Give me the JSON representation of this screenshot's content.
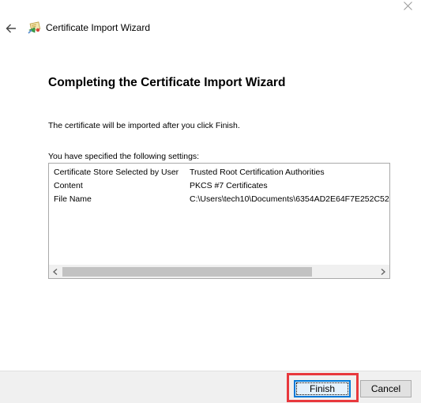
{
  "window": {
    "title": "Certificate Import Wizard"
  },
  "icons": {
    "back": "back-arrow-icon",
    "wizard": "certificate-wizard-icon",
    "close": "close-icon",
    "scroll_left": "chevron-left-icon",
    "scroll_right": "chevron-right-icon"
  },
  "page": {
    "heading": "Completing the Certificate Import Wizard",
    "description": "The certificate will be imported after you click Finish.",
    "settings_label": "You have specified the following settings:"
  },
  "settings": [
    {
      "key": "Certificate Store Selected by User",
      "value": "Trusted Root Certification Authorities"
    },
    {
      "key": "Content",
      "value": "PKCS #7 Certificates"
    },
    {
      "key": "File Name",
      "value": "C:\\Users\\tech10\\Documents\\6354AD2E64F7E252C52"
    }
  ],
  "buttons": {
    "finish": "Finish",
    "cancel": "Cancel"
  },
  "colors": {
    "highlight": "#e8383d",
    "focus_border": "#0078d7",
    "footer_bg": "#f0f0f0"
  }
}
